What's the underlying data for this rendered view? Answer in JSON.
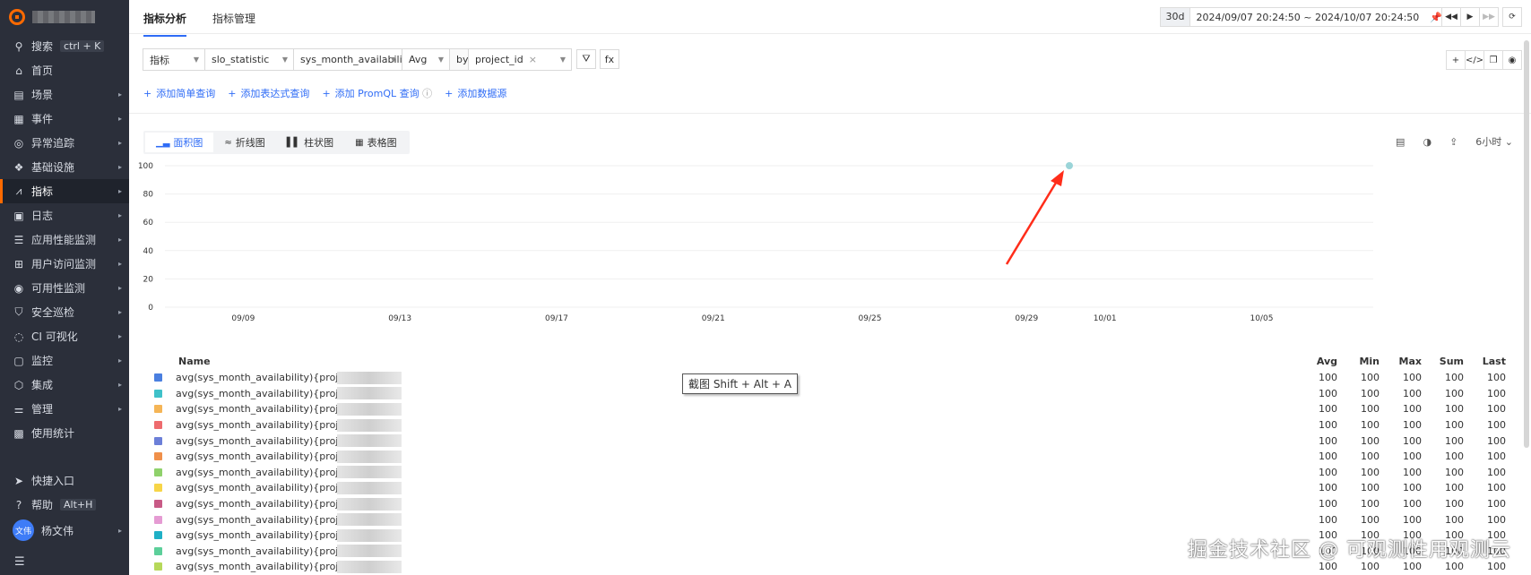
{
  "sidebar": {
    "search_label": "搜索",
    "search_kbd": "ctrl + K",
    "items": [
      {
        "label": "首页",
        "icon": "home-icon",
        "glyph": "⌂",
        "arrow": false
      },
      {
        "label": "场景",
        "icon": "scene-icon",
        "glyph": "▤",
        "arrow": true
      },
      {
        "label": "事件",
        "icon": "event-icon",
        "glyph": "▦",
        "arrow": true
      },
      {
        "label": "异常追踪",
        "icon": "trace-icon",
        "glyph": "◎",
        "arrow": true
      },
      {
        "label": "基础设施",
        "icon": "infra-icon",
        "glyph": "❖",
        "arrow": true
      },
      {
        "label": "指标",
        "icon": "metric-icon",
        "glyph": "⩘",
        "arrow": true,
        "active": true
      },
      {
        "label": "日志",
        "icon": "log-icon",
        "glyph": "▣",
        "arrow": true
      },
      {
        "label": "应用性能监测",
        "icon": "apm-icon",
        "glyph": "☰",
        "arrow": true
      },
      {
        "label": "用户访问监测",
        "icon": "rum-icon",
        "glyph": "⊞",
        "arrow": true
      },
      {
        "label": "可用性监测",
        "icon": "availability-icon",
        "glyph": "◉",
        "arrow": true
      },
      {
        "label": "安全巡检",
        "icon": "security-icon",
        "glyph": "⛉",
        "arrow": true
      },
      {
        "label": "CI 可视化",
        "icon": "ci-icon",
        "glyph": "◌",
        "arrow": true
      },
      {
        "label": "监控",
        "icon": "monitor-icon",
        "glyph": "▢",
        "arrow": true
      },
      {
        "label": "集成",
        "icon": "integration-icon",
        "glyph": "⬡",
        "arrow": true
      },
      {
        "label": "管理",
        "icon": "manage-icon",
        "glyph": "⚌",
        "arrow": true
      },
      {
        "label": "使用统计",
        "icon": "usage-icon",
        "glyph": "▩",
        "arrow": false
      }
    ],
    "quick_entry": "快捷入口",
    "help": "帮助",
    "help_kbd": "Alt+H",
    "user_avatar": "文伟",
    "user_name": "杨文伟"
  },
  "topbar": {
    "tabs": [
      "指标分析",
      "指标管理"
    ],
    "range_tag": "30d",
    "range_text": "2024/09/07 20:24:50 ~ 2024/10/07 20:24:50"
  },
  "query": {
    "type": "指标",
    "measurement": "slo_statistic",
    "field": "sys_month_availability",
    "func": "Avg",
    "by": "by",
    "group": "project_id",
    "fx": "fx"
  },
  "add_links": [
    "添加简单查询",
    "添加表达式查询",
    "添加 PromQL 查询",
    "添加数据源"
  ],
  "chart_tabs": [
    "面积图",
    "折线图",
    "柱状图",
    "表格图"
  ],
  "interval": "6小时",
  "chart_data": {
    "type": "area",
    "y_ticks": [
      "100",
      "80",
      "60",
      "40",
      "20",
      "0"
    ],
    "ylim": [
      0,
      100
    ],
    "x_ticks": [
      "09/09",
      "09/13",
      "09/17",
      "09/21",
      "09/25",
      "09/29",
      "10/01",
      "10/05"
    ],
    "points": [
      {
        "x": "09/30",
        "y": 100
      }
    ]
  },
  "legend": {
    "header": "Name",
    "stat_headers": [
      "Avg",
      "Min",
      "Max",
      "Sum",
      "Last"
    ],
    "rows": [
      {
        "name": "avg(sys_month_availability){proje",
        "color": "#4a7fe0",
        "stats": [
          "100",
          "100",
          "100",
          "100",
          "100"
        ]
      },
      {
        "name": "avg(sys_month_availability){project_id:",
        "color": "#3fc1c9",
        "stats": [
          "100",
          "100",
          "100",
          "100",
          "100"
        ]
      },
      {
        "name": "avg(sys_month_availability){project_id:",
        "color": "#f5b556",
        "stats": [
          "100",
          "100",
          "100",
          "100",
          "100"
        ]
      },
      {
        "name": "avg(sys_month_availability){project_id:",
        "color": "#ee6b6e",
        "stats": [
          "100",
          "100",
          "100",
          "100",
          "100"
        ]
      },
      {
        "name": "avg(sys_month_availability){project_id:",
        "color": "#6c7fd8",
        "stats": [
          "100",
          "100",
          "100",
          "100",
          "100"
        ]
      },
      {
        "name": "avg(sys_month_availability){project_id:",
        "color": "#f0904a",
        "stats": [
          "100",
          "100",
          "100",
          "100",
          "100"
        ]
      },
      {
        "name": "avg(sys_month_availability){project_id:",
        "color": "#8fd16b",
        "stats": [
          "100",
          "100",
          "100",
          "100",
          "100"
        ]
      },
      {
        "name": "avg(sys_month_availability){project_id:",
        "color": "#f7d547",
        "stats": [
          "100",
          "100",
          "100",
          "100",
          "100"
        ]
      },
      {
        "name": "avg(sys_month_availability){project_id:",
        "color": "#c85a86",
        "stats": [
          "100",
          "100",
          "100",
          "100",
          "100"
        ]
      },
      {
        "name": "avg(sys_month_availability){project_id:",
        "color": "#e59bd3",
        "stats": [
          "100",
          "100",
          "100",
          "100",
          "100"
        ]
      },
      {
        "name": "avg(sys_month_availability){project_id:",
        "color": "#1fb0c6",
        "stats": [
          "100",
          "100",
          "100",
          "100",
          "100"
        ]
      },
      {
        "name": "avg(sys_month_availability){project_id:",
        "color": "#5ccf9a",
        "stats": [
          "100",
          "100",
          "100",
          "100",
          "100"
        ]
      },
      {
        "name": "avg(sys_month_availability){project_id:",
        "color": "#b6d85a",
        "stats": [
          "100",
          "100",
          "100",
          "100",
          "100"
        ]
      }
    ]
  },
  "tooltip": "截图 Shift + Alt + A",
  "watermark": "掘金技术社区 @ 可观测性用观测云"
}
